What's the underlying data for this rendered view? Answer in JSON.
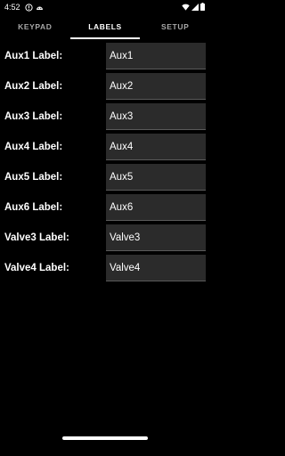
{
  "status_bar": {
    "time": "4:52",
    "left_icons": [
      "alert-icon",
      "robot-icon"
    ],
    "right_icons": [
      "wifi-icon",
      "signal-icon",
      "battery-icon"
    ]
  },
  "tabs": [
    {
      "label": "KEYPAD",
      "active": false
    },
    {
      "label": "LABELS",
      "active": true
    },
    {
      "label": "SETUP",
      "active": false
    }
  ],
  "rows": [
    {
      "label": "Aux1 Label:",
      "value": "Aux1"
    },
    {
      "label": "Aux2 Label:",
      "value": "Aux2"
    },
    {
      "label": "Aux3 Label:",
      "value": "Aux3"
    },
    {
      "label": "Aux4 Label:",
      "value": "Aux4"
    },
    {
      "label": "Aux5 Label:",
      "value": "Aux5"
    },
    {
      "label": "Aux6 Label:",
      "value": "Aux6"
    },
    {
      "label": "Valve3 Label:",
      "value": "Valve3"
    },
    {
      "label": "Valve4 Label:",
      "value": "Valve4"
    }
  ],
  "colors": {
    "background": "#000000",
    "field_background": "#2b2b2b",
    "tab_active": "#ffffff",
    "tab_inactive": "#a8a8a8"
  }
}
